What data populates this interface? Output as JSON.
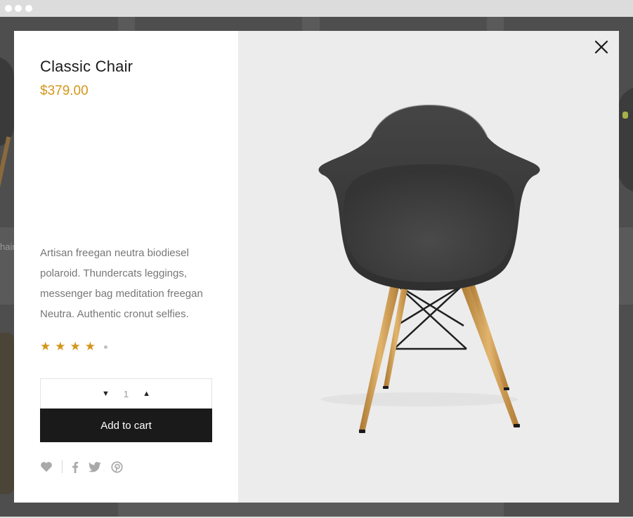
{
  "product": {
    "title": "Classic Chair",
    "price": "$379.00",
    "description": "Artisan freegan neutra biodiesel polaroid. Thundercats leggings, messenger bag meditation freegan Neutra. Authentic cronut selfies.",
    "rating": {
      "value": 4,
      "max": 5
    },
    "quantity": "1"
  },
  "actions": {
    "decrement": "▼",
    "increment": "▲",
    "add_to_cart": "Add to cart"
  },
  "icons": [
    "heart-icon",
    "facebook-icon",
    "twitter-icon",
    "pinterest-icon",
    "close-icon"
  ],
  "background": {
    "partial_text": "hair"
  },
  "colors": {
    "accent": "#d4961a",
    "button": "#1a1a1a",
    "image_bg": "#ececec",
    "backdrop": "#5a5a5a"
  }
}
